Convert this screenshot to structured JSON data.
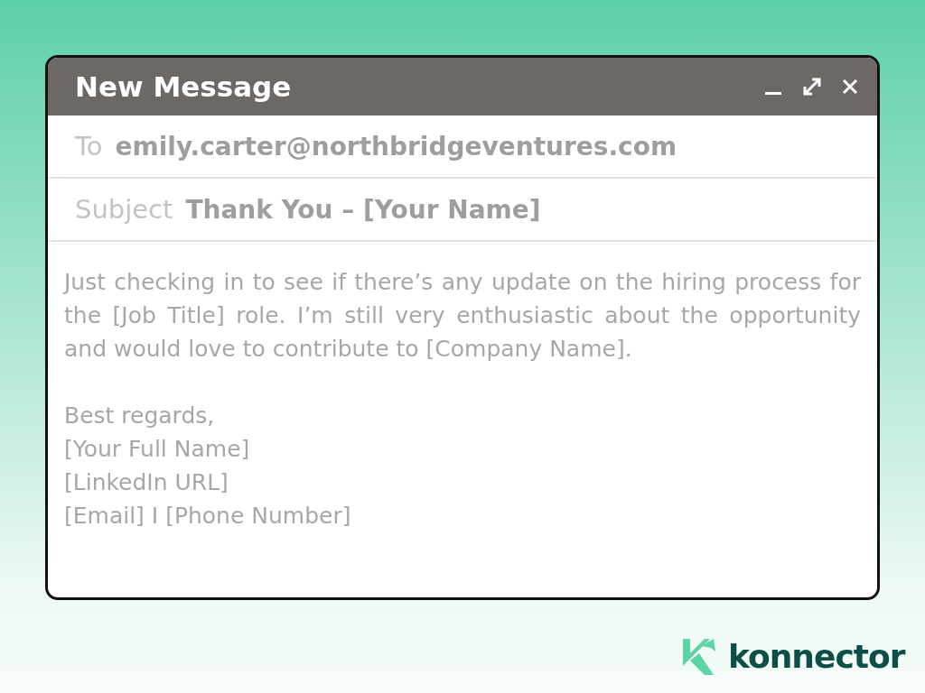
{
  "window": {
    "title": "New Message"
  },
  "fields": [
    {
      "label": "To",
      "value": "emily.carter@northbridgeventures.com"
    },
    {
      "label": "Subject",
      "value": "Thank You – [Your Name]"
    }
  ],
  "body": {
    "paragraph": "Just checking in to see if there’s any update on the hiring process for the [Job Title] role. I’m still very enthusiastic about the opportunity and would love to contribute to [Company Name].",
    "signature": [
      "Best regards,",
      "[Your Full Name]",
      "[LinkedIn URL]",
      "[Email] I [Phone Number]"
    ]
  },
  "brand": {
    "name": "konnector"
  }
}
